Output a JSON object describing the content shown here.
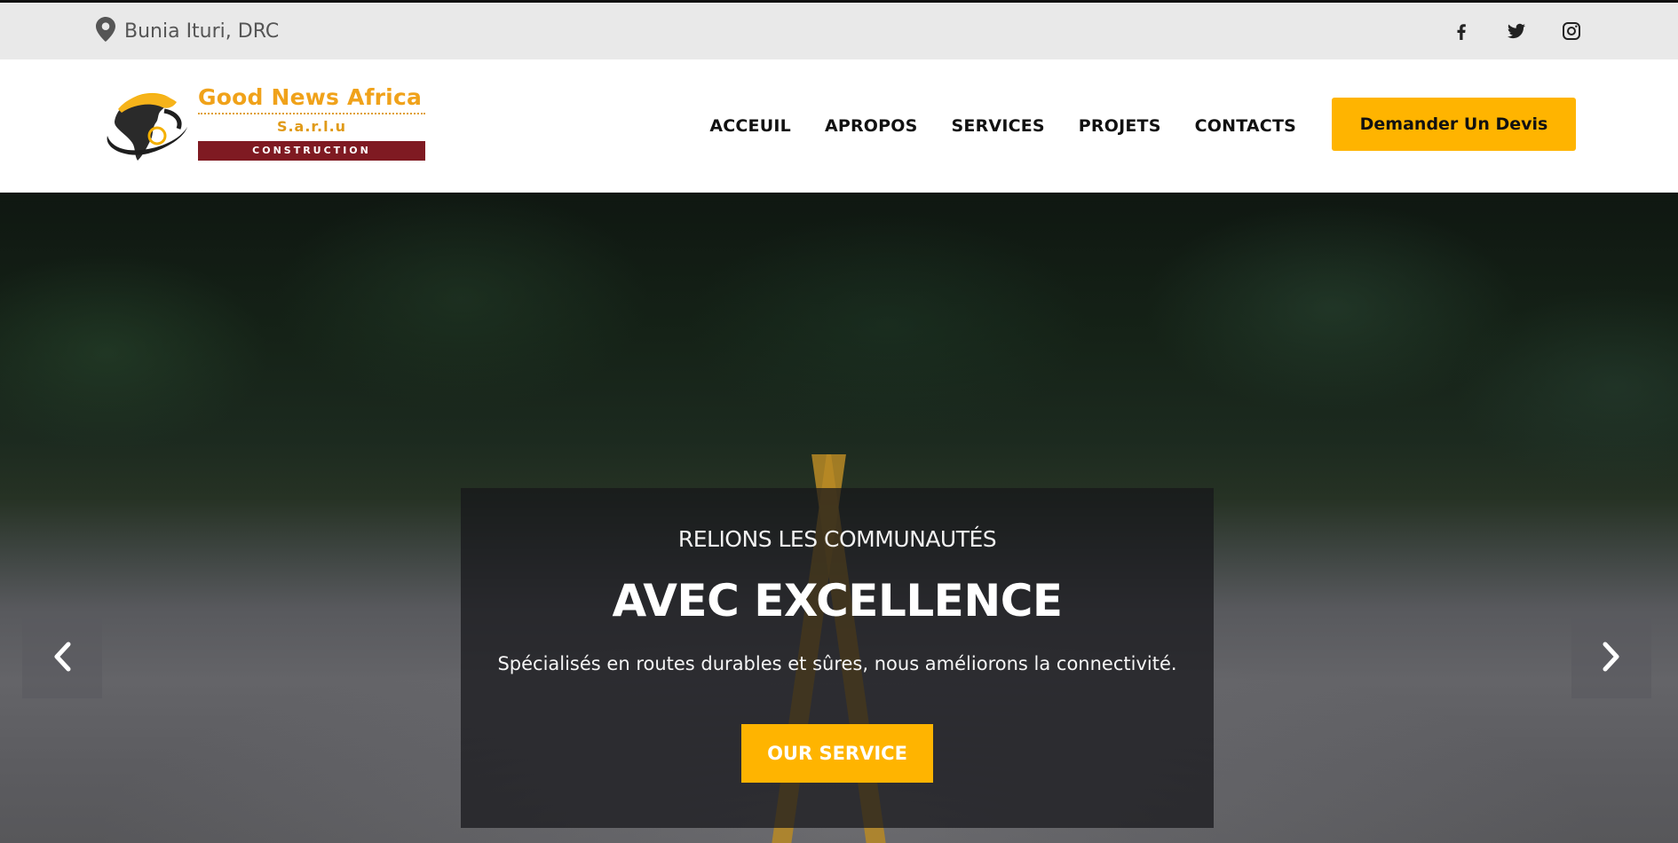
{
  "topbar": {
    "location_icon": "map-marker-icon",
    "location": "Bunia Ituri, DRC",
    "socials": [
      "facebook-icon",
      "twitter-icon",
      "instagram-icon"
    ]
  },
  "logo": {
    "title": "Good News Africa",
    "subtitle": "S.a.r.l.u",
    "band": "CONSTRUCTION"
  },
  "nav": {
    "items": [
      "ACCEUIL",
      "APROPOS",
      "SERVICES",
      "PROJETS",
      "CONTACTS"
    ],
    "cta": "Demander Un Devis"
  },
  "hero": {
    "pretitle": "RELIONS LES COMMUNAUTÉS",
    "title": "AVEC EXCELLENCE",
    "description": "Spécialisés en routes durables et sûres, nous améliorons la connectivité.",
    "button": "OUR SERVICE",
    "prev_icon": "chevron-left-icon",
    "next_icon": "chevron-right-icon"
  },
  "colors": {
    "accent": "#ffb400",
    "logo_orange": "#f0a21a",
    "logo_band": "#7f1a22",
    "topbar_bg": "#e9e9e9"
  }
}
